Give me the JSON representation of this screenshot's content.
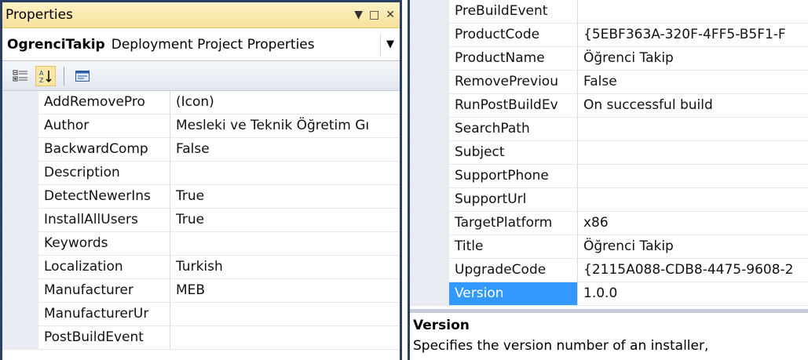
{
  "left_panel": {
    "title": "Properties",
    "controls": {
      "dropdown": "▼",
      "maximize": "□",
      "close": "✕"
    },
    "object_selector": {
      "name": "OgrenciTakip",
      "type": "Deployment Project Properties"
    },
    "rows": [
      {
        "name": "AddRemovePro",
        "value": "(Icon)"
      },
      {
        "name": "Author",
        "value": "Mesleki ve Teknik Öğretim Gı"
      },
      {
        "name": "BackwardComp",
        "value": "False"
      },
      {
        "name": "Description",
        "value": ""
      },
      {
        "name": "DetectNewerIns",
        "value": "True"
      },
      {
        "name": "InstallAllUsers",
        "value": "True"
      },
      {
        "name": "Keywords",
        "value": ""
      },
      {
        "name": "Localization",
        "value": "Turkish"
      },
      {
        "name": "Manufacturer",
        "value": "MEB"
      },
      {
        "name": "ManufacturerUr",
        "value": ""
      },
      {
        "name": "PostBuildEvent",
        "value": ""
      }
    ]
  },
  "right_panel": {
    "rows": [
      {
        "name": "PreBuildEvent",
        "value": ""
      },
      {
        "name": "ProductCode",
        "value": "{5EBF363A-320F-4FF5-B5F1-F"
      },
      {
        "name": "ProductName",
        "value": "Öğrenci Takip"
      },
      {
        "name": "RemovePreviou",
        "value": "False"
      },
      {
        "name": "RunPostBuildEv",
        "value": "On successful build"
      },
      {
        "name": "SearchPath",
        "value": ""
      },
      {
        "name": "Subject",
        "value": ""
      },
      {
        "name": "SupportPhone",
        "value": ""
      },
      {
        "name": "SupportUrl",
        "value": ""
      },
      {
        "name": "TargetPlatform",
        "value": "x86"
      },
      {
        "name": "Title",
        "value": "Öğrenci Takip"
      },
      {
        "name": "UpgradeCode",
        "value": "{2115A088-CDB8-4475-9608-2"
      },
      {
        "name": "Version",
        "value": "1.0.0",
        "selected": true
      }
    ],
    "description": {
      "title": "Version",
      "text": "Specifies the version number of an installer,"
    }
  },
  "icons": {
    "categorized": "categorized-icon",
    "alphabetical": "sort-alphabetical-icon",
    "property_pages": "property-pages-icon"
  },
  "colors": {
    "titlebar": "#f7e09b",
    "selected": "#3399ff",
    "frame": "#2c3e63"
  }
}
